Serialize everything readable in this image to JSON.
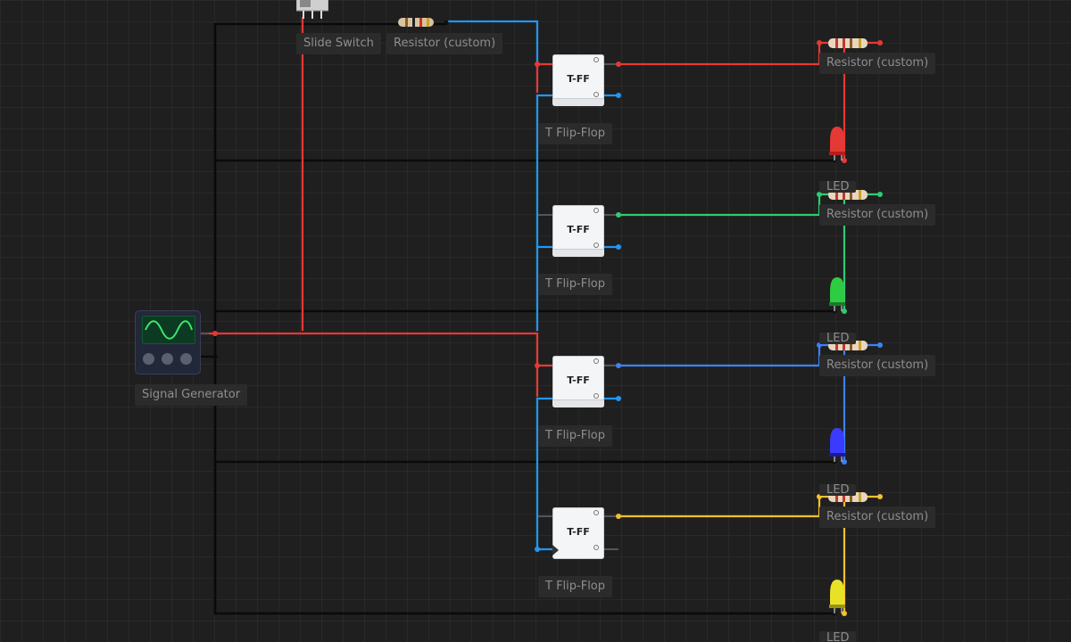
{
  "canvas": {
    "background": "#1f1f1f"
  },
  "wire_colors": {
    "signal": "#e53935",
    "clock_chain": "#2196f3",
    "ground": "#0a0a0a",
    "out_red": "#e53935",
    "out_green": "#2ecc71",
    "out_blue": "#3b82f6",
    "out_yellow": "#f2c12e"
  },
  "components": {
    "slide_switch": {
      "label": "Slide Switch"
    },
    "resistor_top": {
      "label": "Resistor (custom)"
    },
    "signal_generator": {
      "label": "Signal Generator"
    },
    "flip_flops": [
      {
        "title": "T-FF",
        "label": "T Flip-Flop"
      },
      {
        "title": "T-FF",
        "label": "T Flip-Flop"
      },
      {
        "title": "T-FF",
        "label": "T Flip-Flop"
      },
      {
        "title": "T-FF",
        "label": "T Flip-Flop"
      }
    ],
    "output_stages": [
      {
        "resistor_label": "Resistor (custom)",
        "led_label": "LED",
        "led_color": "red"
      },
      {
        "resistor_label": "Resistor (custom)",
        "led_label": "LED",
        "led_color": "green"
      },
      {
        "resistor_label": "Resistor (custom)",
        "led_label": "LED",
        "led_color": "blue"
      },
      {
        "resistor_label": "Resistor (custom)",
        "led_label": "LED",
        "led_color": "yellow"
      }
    ]
  }
}
